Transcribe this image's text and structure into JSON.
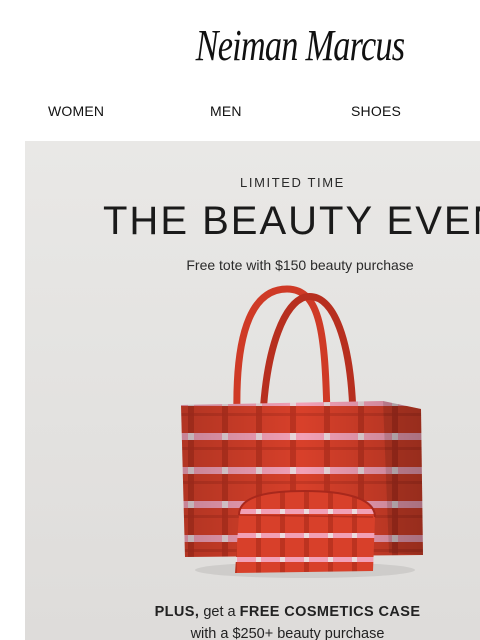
{
  "brand": {
    "logo_text": "Neiman Marcus"
  },
  "nav": {
    "items": [
      "WOMEN",
      "MEN",
      "SHOES"
    ]
  },
  "hero": {
    "kicker": "LIMITED TIME",
    "headline": "THE BEAUTY EVENT",
    "subline": "Free tote with $150 beauty purchase",
    "promo": {
      "plus": "PLUS,",
      "get_a": "get a",
      "offer": "FREE COSMETICS CASE",
      "condition": "with a $250+ beauty purchase"
    },
    "image": {
      "icon": "plaid-tote-and-cosmetics-case-image"
    }
  },
  "colors": {
    "tote_red": "#d8402a",
    "tote_pink": "#f4a0b8",
    "tote_dark": "#a8281c",
    "hero_bg": "#e6e5e3"
  }
}
